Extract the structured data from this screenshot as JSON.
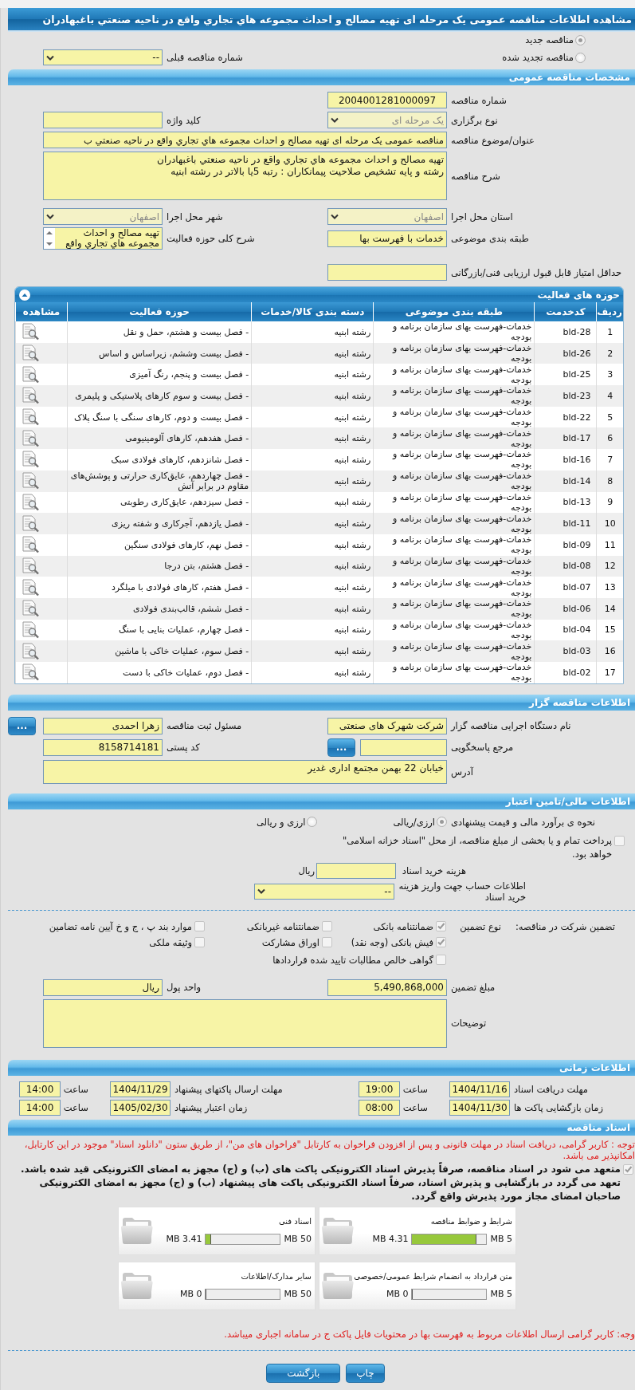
{
  "window": {
    "title": "مشاهده اطلاعات مناقصه عمومی یک مرحله ای تهیه مصالح و احداث مجموعه هاي تجاري واقع در ناحيه صنعتي باغبهادران"
  },
  "tender_kind": {
    "options": [
      {
        "label": "مناقصه جدید",
        "selected": true
      },
      {
        "label": "مناقصه تجدید شده",
        "selected": false
      }
    ],
    "previous": {
      "label": "شماره مناقصه قبلی",
      "kind": "select",
      "value": "--",
      "disabled": false
    }
  },
  "general": {
    "title": "مشخصات مناقصه عمومی",
    "rows": [
      [
        {
          "label": "شماره مناقصه",
          "kind": "code",
          "value": "2004001281000097"
        }
      ],
      [
        {
          "label": "نوع برگزاری",
          "kind": "select",
          "value": "یک مرحله ای",
          "disabled": true
        },
        {
          "label": "کلید واژه",
          "kind": "text"
        }
      ],
      [
        {
          "label": "عنوان/موضوع مناقصه",
          "kind": "long_text",
          "value": "مناقصه عمومی یک مرحله ای تهیه مصالح و احداث مجموعه هاي تجاري واقع در ناحيه صنعتي ب"
        }
      ],
      [
        {
          "label": "شرح مناقصه",
          "kind": "textarea",
          "lines": [
            "تهیه مصالح و احداث مجموعه هاي تجاري واقع در ناحيه صنعتي باغبهادران",
            "رشته و پایه تشخیص صلاحیت پیمانکاران : رتبه 5یا بالاتر در رشته  ابنیه"
          ]
        }
      ],
      [
        {
          "label": "استان محل اجرا",
          "kind": "select",
          "value": "اصفهان",
          "disabled": true
        },
        {
          "label": "شهر محل اجرا",
          "kind": "select",
          "value": "اصفهان",
          "disabled": true
        }
      ],
      [
        {
          "label": "طبقه بندی موضوعی",
          "kind": "text",
          "value": "خدمات با فهرست بها"
        },
        {
          "label": "شرح کلی حوزه فعالیت",
          "kind": "listbox",
          "lines": [
            "تهیه مصالح و احداث",
            "مجموعه هاي تجاري واقع"
          ]
        }
      ],
      [
        {
          "label": "حداقل امتیاز قابل قبول ارزیابی فنی/بازرگانی",
          "kind": "text"
        }
      ]
    ]
  },
  "activities": {
    "title": "حوزه های فعالیت",
    "expanded": true,
    "columns": [
      "ردیف",
      "کدخدمت",
      "طبقه بندی موضوعی",
      "دسته بندی کالا/خدمات",
      "حوزه فعالیت",
      "مشاهده"
    ],
    "rows": [
      {
        "index": "1",
        "code": "bld-28",
        "category": "خدمات-فهرست بهای سازمان برنامه و بودجه",
        "group": "رشته ابنیه",
        "activity": "- فصل بیست و هشتم، حمل و نقل"
      },
      {
        "index": "2",
        "code": "bld-26",
        "category": "خدمات-فهرست بهای سازمان برنامه و بودجه",
        "group": "رشته ابنیه",
        "activity": "- فصل بیست وششم، زیراساس و اساس"
      },
      {
        "index": "3",
        "code": "bld-25",
        "category": "خدمات-فهرست بهای سازمان برنامه و بودجه",
        "group": "رشته ابنیه",
        "activity": "- فصل بیست و پنجم، رنگ آمیزی"
      },
      {
        "index": "4",
        "code": "bld-23",
        "category": "خدمات-فهرست بهای سازمان برنامه و بودجه",
        "group": "رشته ابنیه",
        "activity": "- فصل بیست و سوم کارهای پلاستیکی و پلیمری"
      },
      {
        "index": "5",
        "code": "bld-22",
        "category": "خدمات-فهرست بهای سازمان برنامه و بودجه",
        "group": "رشته ابنیه",
        "activity": "- فصل بیست و دوم، کارهای سنگی با سنگ پلاک"
      },
      {
        "index": "6",
        "code": "bld-17",
        "category": "خدمات-فهرست بهای سازمان برنامه و بودجه",
        "group": "رشته ابنیه",
        "activity": "- فصل هفدهم، کارهای آلومینیومی"
      },
      {
        "index": "7",
        "code": "bld-16",
        "category": "خدمات-فهرست بهای سازمان برنامه و بودجه",
        "group": "رشته ابنیه",
        "activity": "- فصل شانزدهم، کارهای فولادی سبک"
      },
      {
        "index": "8",
        "code": "bld-14",
        "category": "خدمات-فهرست بهای سازمان برنامه و بودجه",
        "group": "رشته ابنیه",
        "activity": "- فصل چهاردهم، عایق‌کاری حرارتی و پوشش‌های مقاوم در برابر آتش"
      },
      {
        "index": "9",
        "code": "bld-13",
        "category": "خدمات-فهرست بهای سازمان برنامه و بودجه",
        "group": "رشته ابنیه",
        "activity": "- فصل سیزدهم، عایق‌کاری رطوبتی"
      },
      {
        "index": "10",
        "code": "bld-11",
        "category": "خدمات-فهرست بهای سازمان برنامه و بودجه",
        "group": "رشته ابنیه",
        "activity": "- فصل یازدهم، آجرکاری و شفته ریزی"
      },
      {
        "index": "11",
        "code": "bld-09",
        "category": "خدمات-فهرست بهای سازمان برنامه و بودجه",
        "group": "رشته ابنیه",
        "activity": "- فصل نهم، کارهای فولادی سنگین"
      },
      {
        "index": "12",
        "code": "bld-08",
        "category": "خدمات-فهرست بهای سازمان برنامه و بودجه",
        "group": "رشته ابنیه",
        "activity": "- فصل هشتم، بتن درجا"
      },
      {
        "index": "13",
        "code": "bld-07",
        "category": "خدمات-فهرست بهای سازمان برنامه و بودجه",
        "group": "رشته ابنیه",
        "activity": "- فصل هفتم، کارهای فولادی با میلگرد"
      },
      {
        "index": "14",
        "code": "bld-06",
        "category": "خدمات-فهرست بهای سازمان برنامه و بودجه",
        "group": "رشته ابنیه",
        "activity": "- فصل ششم، قالب‌بندی فولادی"
      },
      {
        "index": "15",
        "code": "bld-04",
        "category": "خدمات-فهرست بهای سازمان برنامه و بودجه",
        "group": "رشته ابنیه",
        "activity": "- فصل چهارم، عملیات بنایی با سنگ"
      },
      {
        "index": "16",
        "code": "bld-03",
        "category": "خدمات-فهرست بهای سازمان برنامه و بودجه",
        "group": "رشته ابنیه",
        "activity": "- فصل سوم، عملیات خاکی با ماشین"
      },
      {
        "index": "17",
        "code": "bld-02",
        "category": "خدمات-فهرست بهای سازمان برنامه و بودجه",
        "group": "رشته ابنیه",
        "activity": "- فصل دوم، عملیات خاکی با دست"
      }
    ]
  },
  "organizer": {
    "title": "اطلاعات مناقصه گزار",
    "rows": [
      [
        {
          "label": "نام دستگاه اجرایی مناقصه گزار",
          "kind": "text",
          "value": "شرکت شهرک های صنعتی"
        },
        {
          "label": "مسئول ثبت مناقصه",
          "kind": "text",
          "value": "زهرا احمدی",
          "button": "..."
        }
      ],
      [
        {
          "label": "مرجع پاسخگویی",
          "kind": "text",
          "button": "..."
        },
        {
          "label": "کد پستی",
          "kind": "text",
          "value": "8158714181"
        }
      ],
      [
        {
          "label": "آدرس",
          "kind": "textarea",
          "lines": [
            "خیابان 22 بهمن مجتمع اداری غدیر"
          ]
        }
      ]
    ]
  },
  "finance": {
    "title": "اطلاعات مالی/تامین اعتبار",
    "estimate": {
      "label": "نحوه ی برآورد مالی و قیمت پیشنهادی",
      "options": [
        {
          "label": "ارزی/ریالی",
          "selected": true
        },
        {
          "label": "ارزی و ریالی",
          "selected": false
        }
      ]
    },
    "treasury": {
      "label": "پرداخت تمام و یا بخشی از مبلغ مناقصه، از محل \"اسناد خزانه اسلامی\" خواهد بود.",
      "checked": false
    },
    "doc_fee": {
      "label": "هزینه خرید اسناد",
      "unit": "ریال"
    },
    "account": {
      "label": "اطلاعات حساب جهت واریز هزینه خرید اسناد",
      "value": "--"
    },
    "guarantee": {
      "label": "تضمین شرکت در مناقصه:",
      "type_label": "نوع تضمین",
      "options": [
        {
          "label": "ضمانتنامه بانکی",
          "checked": true
        },
        {
          "label": "ضمانتنامه غیربانکی",
          "checked": false
        },
        {
          "label": "موارد بند پ ، ج و خ آیین نامه تضامین",
          "checked": false
        },
        {
          "label": "فیش بانکی (وجه نقد)",
          "checked": true
        },
        {
          "label": "اوراق مشارکت",
          "checked": false
        },
        {
          "label": "وثیقه ملکی",
          "checked": false
        },
        {
          "label": "گواهی خالص مطالبات تایید شده قراردادها",
          "checked": false
        }
      ]
    },
    "amount_rows": [
      [
        {
          "label": "مبلغ تضمین",
          "kind": "text",
          "value": "5,490,868,000"
        },
        {
          "label": "واحد پول",
          "kind": "text",
          "value": "ریال"
        }
      ],
      [
        {
          "label": "توضیحات",
          "kind": "textarea"
        }
      ]
    ]
  },
  "timing": {
    "title": "اطلاعات زمانی",
    "items": [
      {
        "label": "مهلت دریافت اسناد",
        "date": "1404/11/16",
        "time_label": "ساعت",
        "time": "19:00"
      },
      {
        "label": "مهلت ارسال پاکتهای پیشنهاد",
        "date": "1404/11/29",
        "time_label": "ساعت",
        "time": "14:00"
      },
      {
        "label": "زمان بازگشایی پاکت ها",
        "date": "1404/11/30",
        "time_label": "ساعت",
        "time": "08:00"
      },
      {
        "label": "زمان اعتبار پیشنهاد",
        "date": "1405/02/30",
        "time_label": "ساعت",
        "time": "14:00"
      }
    ]
  },
  "documents": {
    "title": "اسناد مناقصه",
    "notice": "توجه : کاربر گرامی، دریافت اسناد در مهلت قانونی و پس از افزودن فراخوان به کارتابل \"فراخوان های من\"، از طریق ستون \"دانلود اسناد\" موجود در این کارتابل، امکانپذیر می باشد.",
    "pledge": {
      "text": "متعهد می شود در اسناد مناقصه، صرفاً پذیرش اسناد الکترونیکی پاکت های (ب) و (ج) مجهز به امضای الکترونیکی قید شده باشد. تعهد می گردد در بازگشایی و پذیرش اسناد، صرفاً اسناد الکترونیکی پاکت های پیشنهاد (ب) و (ج) مجهز به امضای الکترونیکی صاحبان امضای مجاز مورد پذیرش واقع گردد.",
      "checked": true
    },
    "files": [
      {
        "name": "شرایط و ضوابط مناقصه",
        "size": "4.31 MB",
        "max": "5 MB",
        "level": 0.862
      },
      {
        "name": "اسناد فنی",
        "size": "3.41 MB",
        "max": "50 MB",
        "level": 0.068
      },
      {
        "name": "متن قرارداد به انضمام شرایط عمومی/خصوصی",
        "size": "0 MB",
        "max": "5 MB",
        "level": 0
      },
      {
        "name": "سایر مدارک/اطلاعات",
        "size": "0 MB",
        "max": "50 MB",
        "level": 0
      }
    ],
    "footer_note": "وجه: کاربر گرامی ارسال اطلاعات مربوط به فهرست بها در محتویات فایل پاکت ج در سامانه اجباری میباشد."
  },
  "actions": [
    {
      "label": "چاپ"
    },
    {
      "label": "بازگشت"
    }
  ]
}
